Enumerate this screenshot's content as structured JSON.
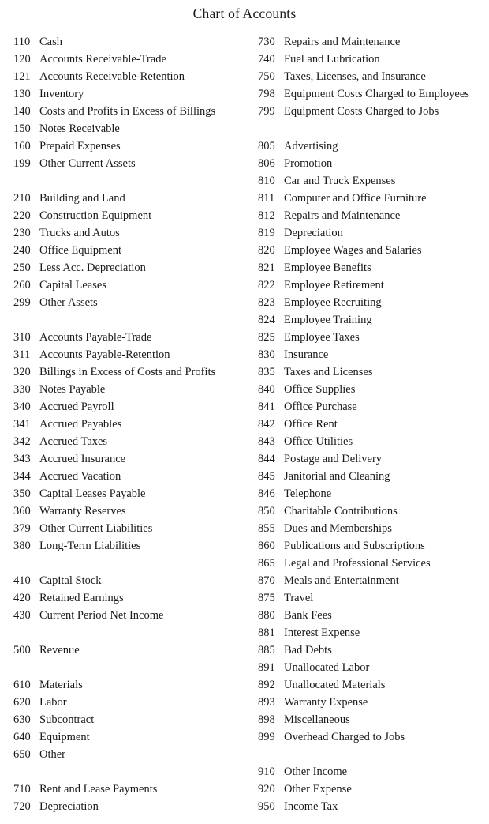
{
  "document": {
    "title": "Chart of Accounts",
    "text_color": "#1a1a1a",
    "background_color": "#ffffff"
  },
  "columns": {
    "left": {
      "groups": [
        {
          "name": "current-assets",
          "rows": [
            {
              "code": "110",
              "name": "Cash"
            },
            {
              "code": "120",
              "name": "Accounts Receivable-Trade"
            },
            {
              "code": "121",
              "name": "Accounts Receivable-Retention"
            },
            {
              "code": "130",
              "name": "Inventory"
            },
            {
              "code": "140",
              "name": "Costs and Profits in Excess of Billings"
            },
            {
              "code": "150",
              "name": "Notes Receivable"
            },
            {
              "code": "160",
              "name": "Prepaid Expenses"
            },
            {
              "code": "199",
              "name": "Other Current Assets"
            }
          ]
        },
        {
          "name": "fixed-assets",
          "rows": [
            {
              "code": "210",
              "name": "Building and Land"
            },
            {
              "code": "220",
              "name": "Construction Equipment"
            },
            {
              "code": "230",
              "name": "Trucks and Autos"
            },
            {
              "code": "240",
              "name": "Office Equipment"
            },
            {
              "code": "250",
              "name": "Less Acc. Depreciation"
            },
            {
              "code": "260",
              "name": "Capital Leases"
            },
            {
              "code": "299",
              "name": "Other Assets"
            }
          ]
        },
        {
          "name": "liabilities",
          "rows": [
            {
              "code": "310",
              "name": "Accounts Payable-Trade"
            },
            {
              "code": "311",
              "name": "Accounts Payable-Retention"
            },
            {
              "code": "320",
              "name": "Billings in Excess of Costs and Profits"
            },
            {
              "code": "330",
              "name": "Notes Payable"
            },
            {
              "code": "340",
              "name": "Accrued Payroll"
            },
            {
              "code": "341",
              "name": "Accrued Payables"
            },
            {
              "code": "342",
              "name": "Accrued Taxes"
            },
            {
              "code": "343",
              "name": "Accrued Insurance"
            },
            {
              "code": "344",
              "name": "Accrued Vacation"
            },
            {
              "code": "350",
              "name": "Capital Leases Payable"
            },
            {
              "code": "360",
              "name": "Warranty Reserves"
            },
            {
              "code": "379",
              "name": "Other Current Liabilities"
            },
            {
              "code": "380",
              "name": "Long-Term Liabilities"
            }
          ]
        },
        {
          "name": "equity",
          "rows": [
            {
              "code": "410",
              "name": "Capital Stock"
            },
            {
              "code": "420",
              "name": "Retained Earnings"
            },
            {
              "code": "430",
              "name": "Current Period Net Income"
            }
          ]
        },
        {
          "name": "revenue",
          "rows": [
            {
              "code": "500",
              "name": "Revenue"
            }
          ]
        },
        {
          "name": "cost-of-sales",
          "rows": [
            {
              "code": "610",
              "name": "Materials"
            },
            {
              "code": "620",
              "name": "Labor"
            },
            {
              "code": "630",
              "name": "Subcontract"
            },
            {
              "code": "640",
              "name": "Equipment"
            },
            {
              "code": "650",
              "name": "Other"
            }
          ]
        },
        {
          "name": "equipment-costs",
          "rows": [
            {
              "code": "710",
              "name": "Rent and Lease Payments"
            },
            {
              "code": "720",
              "name": "Depreciation"
            }
          ]
        }
      ]
    },
    "right": {
      "groups": [
        {
          "name": "equipment-costs-continued",
          "rows": [
            {
              "code": "730",
              "name": "Repairs and Maintenance"
            },
            {
              "code": "740",
              "name": "Fuel and Lubrication"
            },
            {
              "code": "750",
              "name": "Taxes, Licenses, and Insurance"
            },
            {
              "code": "798",
              "name": "Equipment Costs Charged to Employees"
            },
            {
              "code": "799",
              "name": "Equipment Costs Charged to Jobs"
            }
          ]
        },
        {
          "name": "overhead-expenses",
          "rows": [
            {
              "code": "805",
              "name": "Advertising"
            },
            {
              "code": "806",
              "name": "Promotion"
            },
            {
              "code": "810",
              "name": "Car and Truck Expenses"
            },
            {
              "code": "811",
              "name": "Computer and Office Furniture"
            },
            {
              "code": "812",
              "name": "Repairs and Maintenance"
            },
            {
              "code": "819",
              "name": "Depreciation"
            },
            {
              "code": "820",
              "name": "Employee Wages and Salaries"
            },
            {
              "code": "821",
              "name": "Employee Benefits"
            },
            {
              "code": "822",
              "name": "Employee Retirement"
            },
            {
              "code": "823",
              "name": "Employee Recruiting"
            },
            {
              "code": "824",
              "name": "Employee Training"
            },
            {
              "code": "825",
              "name": "Employee Taxes"
            },
            {
              "code": "830",
              "name": "Insurance"
            },
            {
              "code": "835",
              "name": "Taxes and Licenses"
            },
            {
              "code": "840",
              "name": "Office Supplies"
            },
            {
              "code": "841",
              "name": "Office Purchase"
            },
            {
              "code": "842",
              "name": "Office Rent"
            },
            {
              "code": "843",
              "name": "Office Utilities"
            },
            {
              "code": "844",
              "name": "Postage and Delivery"
            },
            {
              "code": "845",
              "name": "Janitorial and Cleaning"
            },
            {
              "code": "846",
              "name": "Telephone"
            },
            {
              "code": "850",
              "name": "Charitable Contributions"
            },
            {
              "code": "855",
              "name": "Dues and Memberships"
            },
            {
              "code": "860",
              "name": "Publications and Subscriptions"
            },
            {
              "code": "865",
              "name": "Legal and Professional Services"
            },
            {
              "code": "870",
              "name": "Meals and Entertainment"
            },
            {
              "code": "875",
              "name": "Travel"
            },
            {
              "code": "880",
              "name": "Bank Fees"
            },
            {
              "code": "881",
              "name": "Interest Expense"
            },
            {
              "code": "885",
              "name": "Bad Debts"
            },
            {
              "code": "891",
              "name": "Unallocated Labor"
            },
            {
              "code": "892",
              "name": "Unallocated Materials"
            },
            {
              "code": "893",
              "name": "Warranty Expense"
            },
            {
              "code": "898",
              "name": "Miscellaneous"
            },
            {
              "code": "899",
              "name": "Overhead Charged to Jobs"
            }
          ]
        },
        {
          "name": "other-income-expense",
          "rows": [
            {
              "code": "910",
              "name": "Other Income"
            },
            {
              "code": "920",
              "name": "Other Expense"
            },
            {
              "code": "950",
              "name": "Income Tax"
            }
          ]
        }
      ]
    }
  }
}
